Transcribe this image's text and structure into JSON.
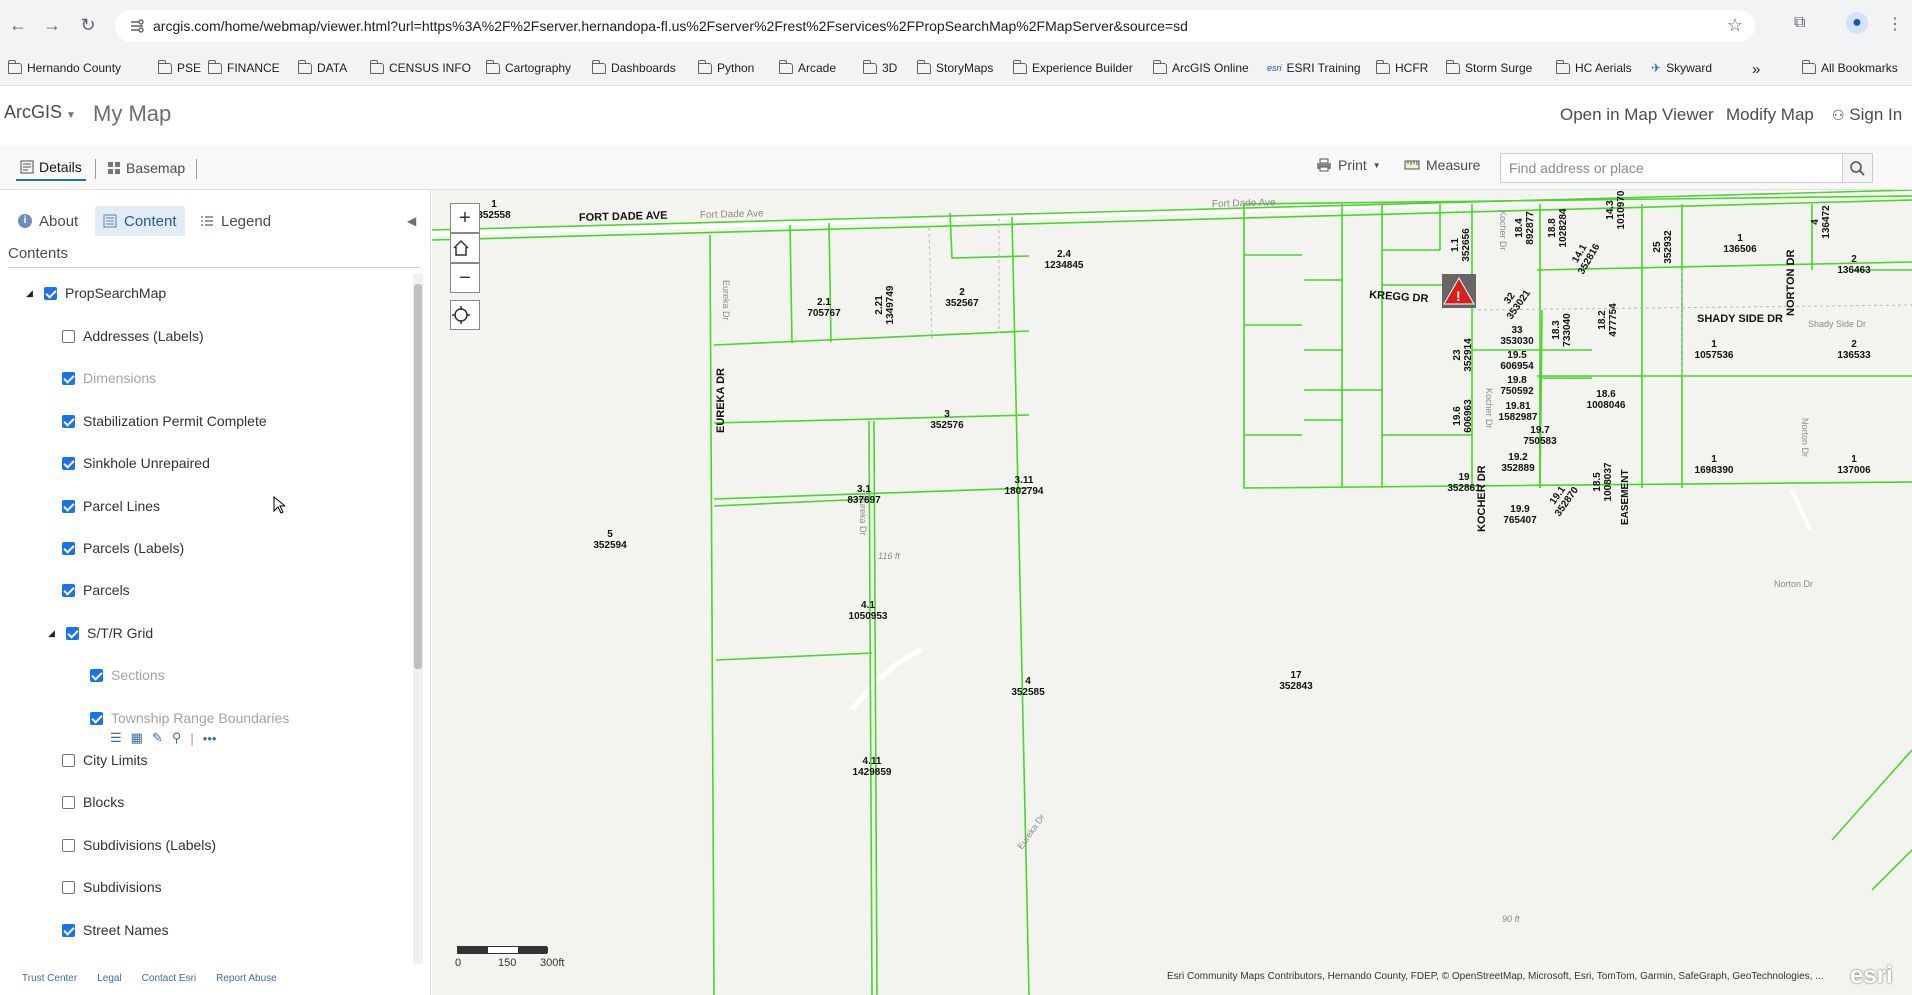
{
  "browser": {
    "url": "arcgis.com/home/webmap/viewer.html?url=https%3A%2F%2Fserver.hernandopa-fl.us%2Fserver%2Frest%2Fservices%2FPropSearchMap%2FMapServer&source=sd",
    "bookmarks": [
      "Hernando County",
      "PSE",
      "FINANCE",
      "DATA",
      "CENSUS INFO",
      "Cartography",
      "Dashboards",
      "Python",
      "Arcade",
      "3D",
      "StoryMaps",
      "Experience Builder",
      "ArcGIS Online",
      "ESRI Training",
      "HCFR",
      "Storm Surge",
      "HC Aerials",
      "Skyward"
    ],
    "bookmarks_overflow": "»",
    "all_bookmarks": "All Bookmarks"
  },
  "header": {
    "brand": "ArcGIS",
    "title": "My Map",
    "open_in_map_viewer": "Open in Map Viewer",
    "modify_map": "Modify Map",
    "sign_in": "Sign In"
  },
  "toolbar": {
    "details": "Details",
    "basemap": "Basemap",
    "print": "Print",
    "measure": "Measure",
    "search_placeholder": "Find address or place"
  },
  "panel": {
    "tabs": {
      "about": "About",
      "content": "Content",
      "legend": "Legend"
    },
    "contents_title": "Contents",
    "layers": [
      {
        "label": "PropSearchMap",
        "checked": true
      },
      {
        "label": "Addresses (Labels)",
        "checked": false
      },
      {
        "label": "Dimensions",
        "checked": true
      },
      {
        "label": "Stabilization Permit Complete",
        "checked": true
      },
      {
        "label": "Sinkhole Unrepaired",
        "checked": true
      },
      {
        "label": "Parcel Lines",
        "checked": true
      },
      {
        "label": "Parcels (Labels)",
        "checked": true
      },
      {
        "label": "Parcels",
        "checked": true
      },
      {
        "label": "S/T/R Grid",
        "checked": true
      },
      {
        "label": "Sections",
        "checked": true
      },
      {
        "label": "Township Range Boundaries",
        "checked": true
      },
      {
        "label": "City Limits",
        "checked": false
      },
      {
        "label": "Blocks",
        "checked": false
      },
      {
        "label": "Subdivisions (Labels)",
        "checked": false
      },
      {
        "label": "Subdivisions",
        "checked": false
      },
      {
        "label": "Street Names",
        "checked": true
      }
    ],
    "layer_tools_more": "•••",
    "footer": [
      "Trust Center",
      "Legal",
      "Contact Esri",
      "Report Abuse"
    ]
  },
  "map": {
    "scale_labels": [
      "0",
      "150",
      "300ft"
    ],
    "attribution": "Esri Community Maps Contributors, Hernando County, FDEP, © OpenStreetMap, Microsoft, Esri, TomTom, Garmin, SafeGraph, GeoTechnologies, ...",
    "esri_logo": "esri",
    "streets": {
      "fort_dade_ave": "FORT DADE AVE",
      "fort_dade_ave_base": "Fort Dade Ave",
      "eureka_dr": "EUREKA DR",
      "eureka_dr_base": "Eureka Dr",
      "kregg_dr": "KREGG DR",
      "kocher_dr": "KOCHER DR",
      "kocher_dr_base": "Kocher Dr",
      "shady_side_dr": "SHADY SIDE DR",
      "shady_side_dr_base": "Shady Side Dr",
      "norton_dr": "NORTON DR",
      "norton_dr_base": "Norton Dr",
      "easement": "EASEMENT"
    },
    "elevations": [
      "116 ft",
      "90 ft"
    ],
    "parcels": [
      {
        "num": "1",
        "id": "352558"
      },
      {
        "num": "2.1",
        "id": "705767"
      },
      {
        "num": "2.21",
        "id": "1349749"
      },
      {
        "num": "2",
        "id": "352567"
      },
      {
        "num": "2.4",
        "id": "1234845"
      },
      {
        "num": "3",
        "id": "352576"
      },
      {
        "num": "3.1",
        "id": "837697"
      },
      {
        "num": "3.11",
        "id": "1802794"
      },
      {
        "num": "5",
        "id": "352594"
      },
      {
        "num": "4.1",
        "id": "1050953"
      },
      {
        "num": "4",
        "id": "352585"
      },
      {
        "num": "4.11",
        "id": "1429859"
      },
      {
        "num": "17",
        "id": "352843"
      },
      {
        "num": "1.1",
        "id": "352656"
      },
      {
        "num": "18.4",
        "id": "892877"
      },
      {
        "num": "18.8",
        "id": "1028284"
      },
      {
        "num": "14.1",
        "id": "352816"
      },
      {
        "num": "14.3",
        "id": "1010970"
      },
      {
        "num": "25",
        "id": "352932"
      },
      {
        "num": "1",
        "id": "136506"
      },
      {
        "num": "4",
        "id": "136472"
      },
      {
        "num": "2",
        "id": "136463"
      },
      {
        "num": "32",
        "id": "353021"
      },
      {
        "num": "33",
        "id": "353030"
      },
      {
        "num": "19.5",
        "id": "606954"
      },
      {
        "num": "19.8",
        "id": "750592"
      },
      {
        "num": "18.3",
        "id": "733040"
      },
      {
        "num": "18.2",
        "id": "477754"
      },
      {
        "num": "23",
        "id": "352914"
      },
      {
        "num": "19.81",
        "id": "1582987"
      },
      {
        "num": "18.6",
        "id": "1008046"
      },
      {
        "num": "19.6",
        "id": "606963"
      },
      {
        "num": "19.7",
        "id": "750583"
      },
      {
        "num": "19.2",
        "id": "352889"
      },
      {
        "num": "19",
        "id": "352861"
      },
      {
        "num": "19.9",
        "id": "765407"
      },
      {
        "num": "19.1",
        "id": "352870"
      },
      {
        "num": "18.5",
        "id": "1008037"
      },
      {
        "num": "1",
        "id": "1057536"
      },
      {
        "num": "2",
        "id": "136533"
      },
      {
        "num": "1",
        "id": "1698390"
      },
      {
        "num": "1",
        "id": "137006"
      }
    ]
  },
  "colors": {
    "parcel_line": "#4bd52b",
    "accent": "#1a73e8",
    "map_bg": "#f3f3f0"
  }
}
